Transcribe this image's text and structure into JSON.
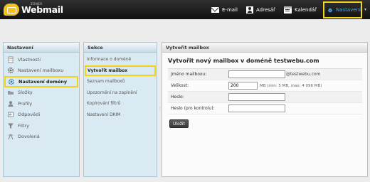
{
  "app": {
    "logo_small": "ZONER",
    "logo_text": "Webmail"
  },
  "nav": {
    "email": "E-mail",
    "contacts": "Adresář",
    "calendar": "Kalendář",
    "settings": "Nastavení"
  },
  "sidebar": {
    "title": "Nastavení",
    "items": [
      {
        "label": "Vlastnosti",
        "icon": "document-icon"
      },
      {
        "label": "Nastavení mailboxu",
        "icon": "gear-icon"
      },
      {
        "label": "Nastavení domény",
        "icon": "gear-icon"
      },
      {
        "label": "Složky",
        "icon": "folder-icon"
      },
      {
        "label": "Profily",
        "icon": "user-icon"
      },
      {
        "label": "Odpovědi",
        "icon": "reply-icon"
      },
      {
        "label": "Filtry",
        "icon": "filter-icon"
      },
      {
        "label": "Dovolená",
        "icon": "vacation-icon"
      }
    ]
  },
  "sections": {
    "title": "Sekce",
    "items": [
      {
        "label": "Informace o doméně"
      },
      {
        "label": "Vytvořit mailbox"
      },
      {
        "label": "Seznam mailboxů"
      },
      {
        "label": "Upozornění na zaplnění"
      },
      {
        "label": "Kopírování filtrů"
      },
      {
        "label": "Nastavení DKIM"
      }
    ]
  },
  "main": {
    "panel_title": "Vytvořit mailbox",
    "heading": "Vytvořit nový mailbox v doméně testwebu.com",
    "fields": {
      "name_label": "Jméno mailboxu:",
      "name_value": "",
      "name_suffix": "@testwebu.com",
      "size_label": "Velikost:",
      "size_value": "200",
      "size_note": "MB (min: 5 MB, max: 4 096 MB)",
      "password_label": "Heslo:",
      "password_check_label": "Heslo (pro kontrolu):"
    },
    "save_label": "Uložit"
  },
  "colors": {
    "highlight": "#f4d21a",
    "topbar": "#1a1a1a",
    "panel_bg": "#daeaf2",
    "settings_blue": "#4ea7e0"
  }
}
